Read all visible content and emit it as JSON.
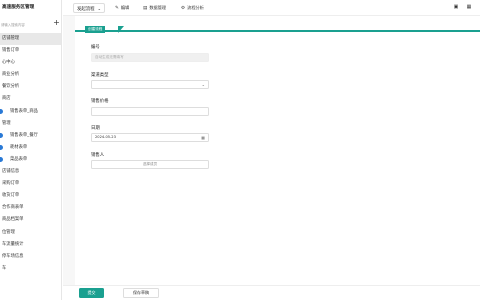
{
  "sidebar": {
    "title": "高速服务区管理",
    "search_placeholder": "请输入搜索内容",
    "add_icon": "plus-icon",
    "items": [
      {
        "label": "店铺管理",
        "active": true,
        "sub": false
      },
      {
        "label": "销售订单",
        "active": false,
        "sub": false
      },
      {
        "label": "心中心",
        "active": false,
        "sub": false
      },
      {
        "label": "商业分析",
        "active": false,
        "sub": false
      },
      {
        "label": "餐饮分析",
        "active": false,
        "sub": false
      },
      {
        "label": "商店",
        "active": false,
        "sub": false
      },
      {
        "label": "销售表单_商品",
        "active": false,
        "sub": true
      },
      {
        "label": "管理",
        "active": false,
        "sub": false
      },
      {
        "label": "销售表单_餐厅",
        "active": false,
        "sub": true
      },
      {
        "label": "耗材表单",
        "active": false,
        "sub": true
      },
      {
        "label": "菜品表单",
        "active": false,
        "sub": true
      },
      {
        "label": "店铺信息",
        "active": false,
        "sub": false
      },
      {
        "label": "采购订单",
        "active": false,
        "sub": false
      },
      {
        "label": "收货订单",
        "active": false,
        "sub": false
      },
      {
        "label": "合作商表单",
        "active": false,
        "sub": false
      },
      {
        "label": "商品档案单",
        "active": false,
        "sub": false
      },
      {
        "label": "位管理",
        "active": false,
        "sub": false
      },
      {
        "label": "车流量统计",
        "active": false,
        "sub": false
      },
      {
        "label": "停车场信息",
        "active": false,
        "sub": false
      },
      {
        "label": "车",
        "active": false,
        "sub": false
      }
    ]
  },
  "topbar": {
    "switcher_label": "发起流程",
    "edit_label": "编辑",
    "data_label": "数据管理",
    "process_label": "流程分析"
  },
  "form": {
    "tab_label": "创建流程",
    "fields": {
      "code_label": "编号",
      "code_placeholder": "自动生成无需填写",
      "channel_label": "渠道类型",
      "price_label": "销售价格",
      "date_label": "日期",
      "date_value": "2024-05-23",
      "seller_label": "销售人",
      "seller_button": "选择成员"
    }
  },
  "footer": {
    "submit_label": "提交",
    "save_draft_label": "保存草稿"
  },
  "colors": {
    "accent": "#1aa090",
    "sidebar_dot": "#2979d6"
  }
}
